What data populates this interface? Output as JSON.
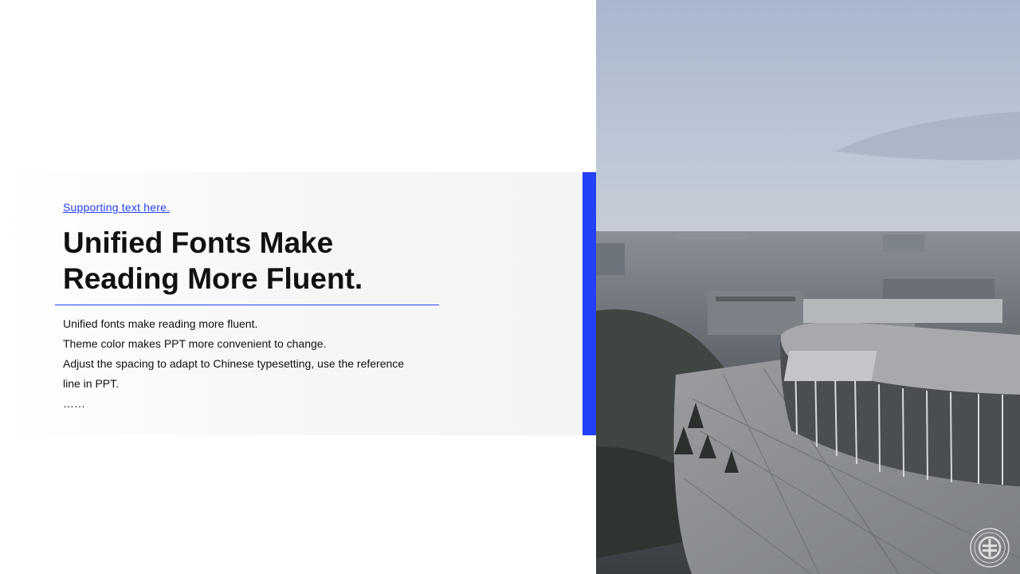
{
  "slide": {
    "supporting_text": "Supporting text here.",
    "title_lines": [
      "Unified Fonts Make",
      "Reading More Fluent."
    ],
    "body_lines": [
      "Unified fonts make reading more fluent.",
      "Theme color makes PPT more convenient to change.",
      "Adjust the spacing to adapt to Chinese typesetting, use the reference",
      "line in PPT.",
      "……"
    ]
  },
  "image": {
    "subject": "campus-aerial-photo-icon",
    "logo": "university-seal-icon"
  },
  "colors": {
    "accent": "#2340f5",
    "title": "#111111",
    "panel": "#f4f4f4",
    "photo_sky": "#b8c3d6"
  }
}
